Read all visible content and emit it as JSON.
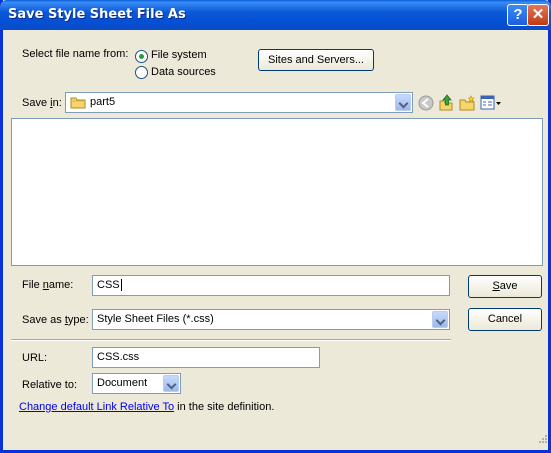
{
  "window": {
    "title": "Save Style Sheet File As",
    "help_symbol": "?",
    "close_symbol": "✕"
  },
  "source": {
    "label": "Select file name from:",
    "options": [
      "File system",
      "Data sources"
    ],
    "selected": "File system",
    "sites_button": "Sites and Servers..."
  },
  "save_in": {
    "label_pre": "Save ",
    "label_acc": "i",
    "label_post": "n:",
    "value": "part5"
  },
  "file_name": {
    "label_pre": "File ",
    "label_acc": "n",
    "label_post": "ame:",
    "value": "CSS"
  },
  "save_as_type": {
    "label_pre": "Save as ",
    "label_acc": "t",
    "label_post": "ype:",
    "value": "Style Sheet Files (*.css)"
  },
  "buttons": {
    "save_acc": "S",
    "save_rest": "ave",
    "cancel": "Cancel"
  },
  "url": {
    "label": "URL:",
    "value": "CSS.css"
  },
  "relative_to": {
    "label": "Relative to:",
    "value": "Document"
  },
  "footer": {
    "link_text": "Change default Link Relative To",
    "rest_text": " in the site definition."
  },
  "colors": {
    "titlebar": "#0b5ad9",
    "dialog_bg": "#ece9d8",
    "link": "#0000ee"
  }
}
